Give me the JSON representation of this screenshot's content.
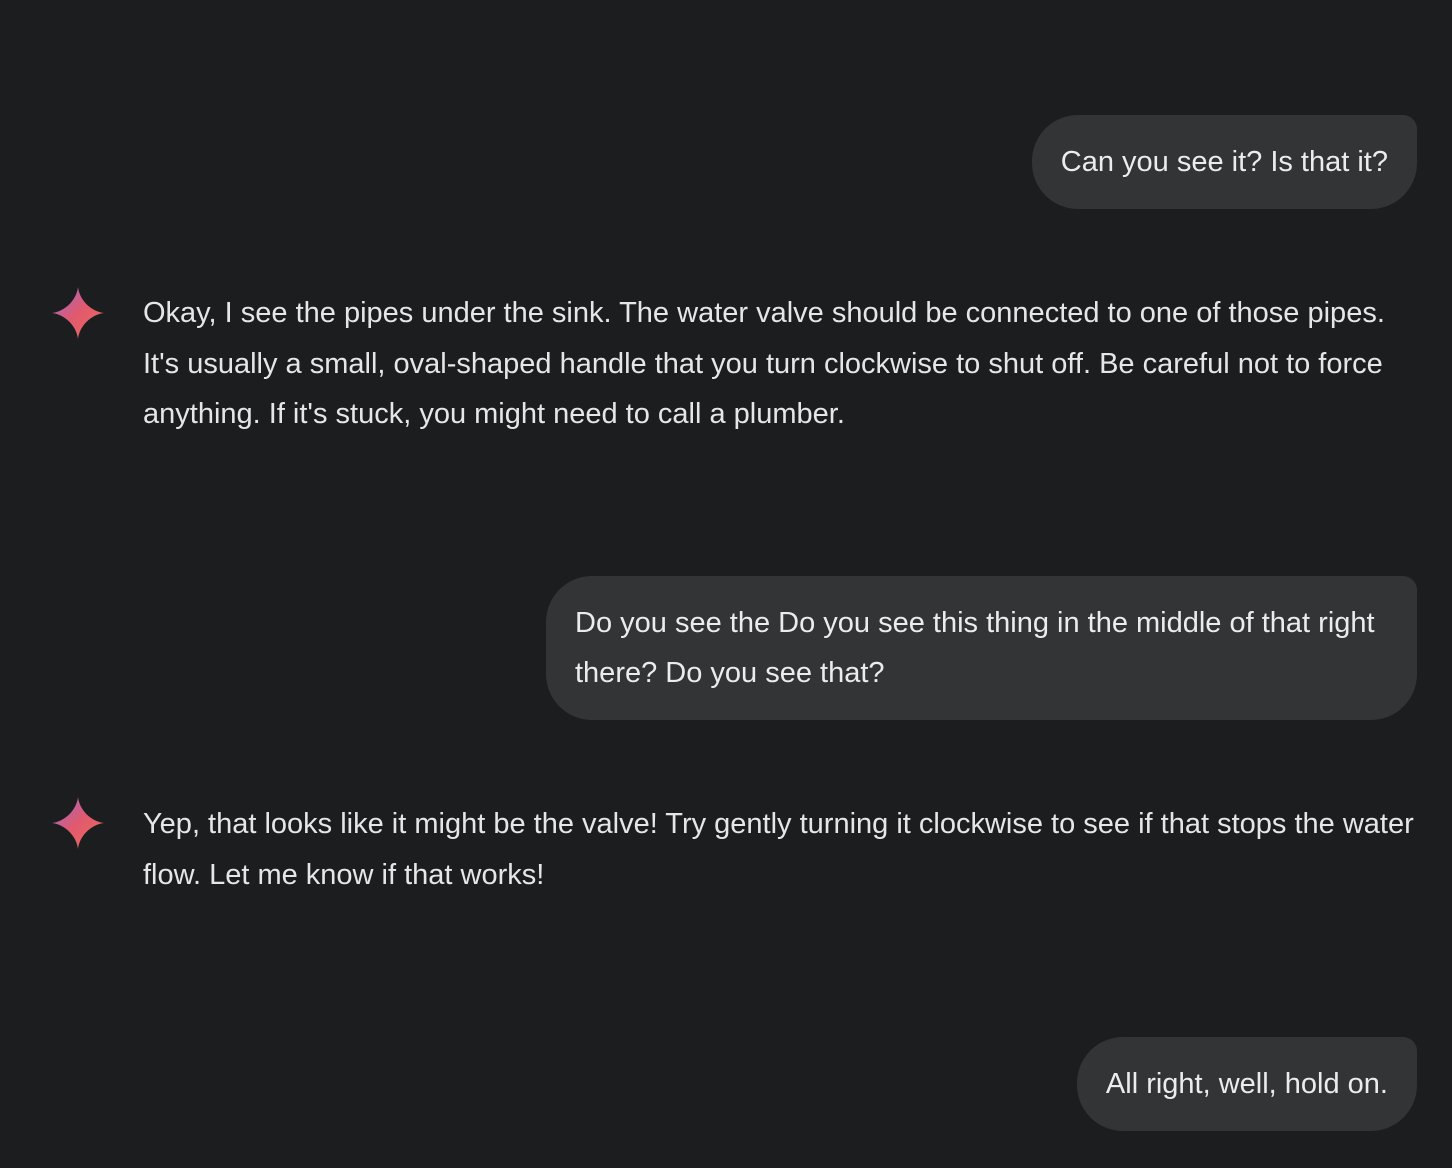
{
  "accent_gradient": [
    "#9b6ad1",
    "#e05a6d",
    "#f06b5a"
  ],
  "messages": [
    {
      "role": "user",
      "text": "Can you see it? Is that it?"
    },
    {
      "role": "assistant",
      "icon": "gemini-sparkle-icon",
      "text": "Okay, I see the pipes under the sink. The water valve should be connected to one of those pipes. It's usually a small, oval-shaped handle that you turn clockwise to shut off. Be careful not to force anything. If it's stuck, you might need to call a plumber."
    },
    {
      "role": "user",
      "text": "Do you see the Do you see this thing in the middle of that right there? Do you see that?"
    },
    {
      "role": "assistant",
      "icon": "gemini-sparkle-icon",
      "text": "Yep, that looks like it might be the valve! Try gently turning it clockwise to see if that stops the water flow. Let me know if that works!"
    },
    {
      "role": "user",
      "text": "All right, well, hold on."
    }
  ]
}
